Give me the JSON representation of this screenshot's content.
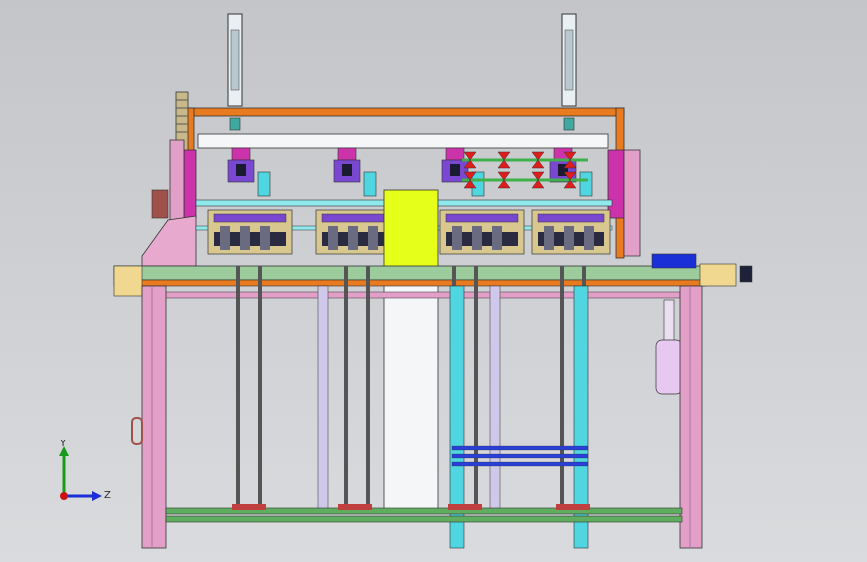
{
  "view": {
    "background_top": "#c3c5c9",
    "background_bottom": "#d9dbde"
  },
  "triad": {
    "y_label": "Y",
    "z_label": "Z",
    "y_color": "#1a9a1a",
    "z_color": "#1a2fd6",
    "x_color": "#cc1111"
  },
  "colors": {
    "frame_pink": "#e2a0c8",
    "beam_orange": "#e87a20",
    "rail_green": "#7cc87c",
    "magenta": "#cc33aa",
    "cyan": "#4fd6e0",
    "yellow_panel": "#e6ff1a",
    "white_panel": "#f4f6f8",
    "blue_bars": "#2a3fd8",
    "red_parts": "#e01c1c",
    "purple": "#7a48d0",
    "tan": "#d8c890"
  }
}
